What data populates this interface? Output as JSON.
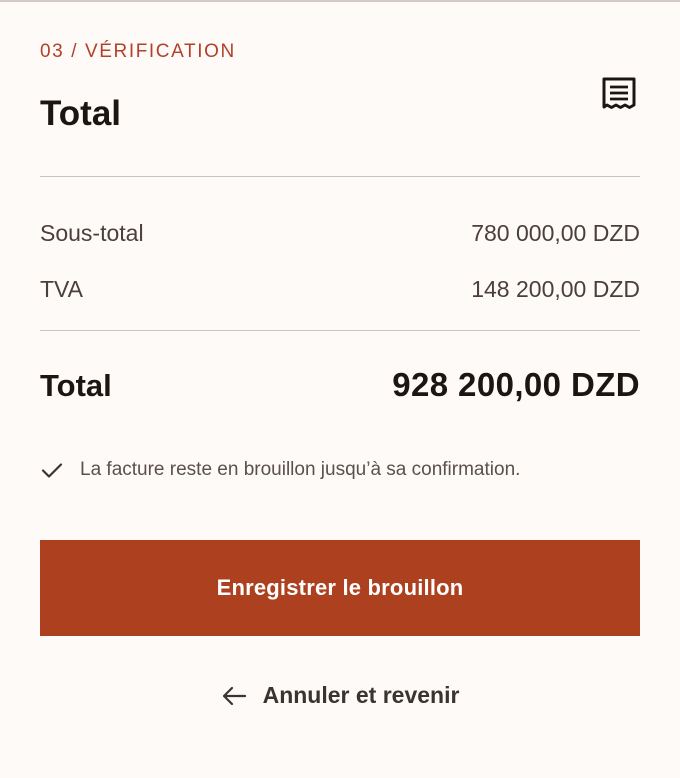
{
  "header": {
    "step_label": "03 / VÉRIFICATION",
    "title": "Total",
    "icon": "receipt-icon"
  },
  "summary": {
    "subtotal": {
      "label": "Sous-total",
      "value": "780 000,00 DZD"
    },
    "tva": {
      "label": "TVA",
      "value": "148 200,00 DZD"
    },
    "total": {
      "label": "Total",
      "value": "928 200,00 DZD"
    }
  },
  "note": {
    "icon": "check-icon",
    "text": "La facture reste en brouillon jusqu’à sa confirmation."
  },
  "actions": {
    "save_label": "Enregistrer le brouillon",
    "cancel_label": "Annuler et revenir",
    "cancel_icon": "arrow-left-icon"
  },
  "colors": {
    "accent": "#ac401f",
    "step_text": "#b14128",
    "background": "#fefaf8"
  }
}
